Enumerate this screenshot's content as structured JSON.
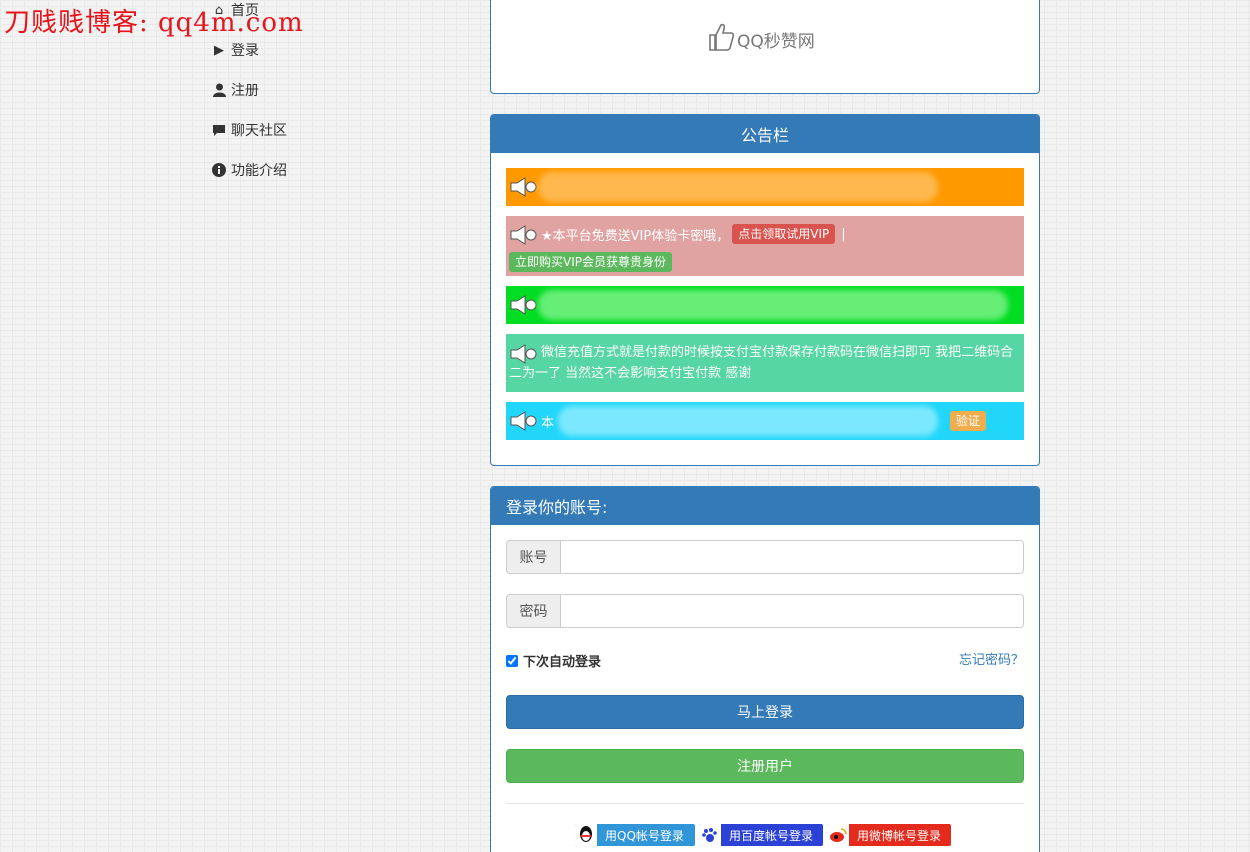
{
  "watermark": "刀贱贱博客: qq4m.com",
  "nav": {
    "home": "首页",
    "login": "登录",
    "register": "注册",
    "chat": "聊天社区",
    "features": "功能介绍"
  },
  "logo": {
    "text": "QQ秒赞网"
  },
  "notice": {
    "title": "公告栏",
    "item2_text": "★本平台免费送VIP体验卡密哦，",
    "item2_btn1": "点击领取试用VIP",
    "item2_sep": "|",
    "item2_btn2": "立即购买VIP会员获尊贵身份",
    "item4_text": "微信充值方式就是付款的时候按支付宝付款保存付款码在微信扫即可 我把二维码合二为一了 当然这不会影响支付宝付款 感谢",
    "item5_prefix": "本",
    "item5_btn": "验证"
  },
  "login": {
    "title": "登录你的账号:",
    "account_label": "账号",
    "account_value": "",
    "password_label": "密码",
    "password_value": "",
    "remember_label": "下次自动登录",
    "forgot": "忘记密码？",
    "submit": "马上登录",
    "register": "注册用户",
    "qq_login": "用QQ帐号登录",
    "baidu_login": "用百度帐号登录",
    "weibo_login": "用微博帐号登录"
  },
  "colors": {
    "primary": "#337ab7",
    "success": "#5cb85c",
    "orange": "#ff9900",
    "pink": "#e0a3a1",
    "green": "#00dd22",
    "mint": "#55d6a2",
    "cyan": "#22d6f9"
  }
}
